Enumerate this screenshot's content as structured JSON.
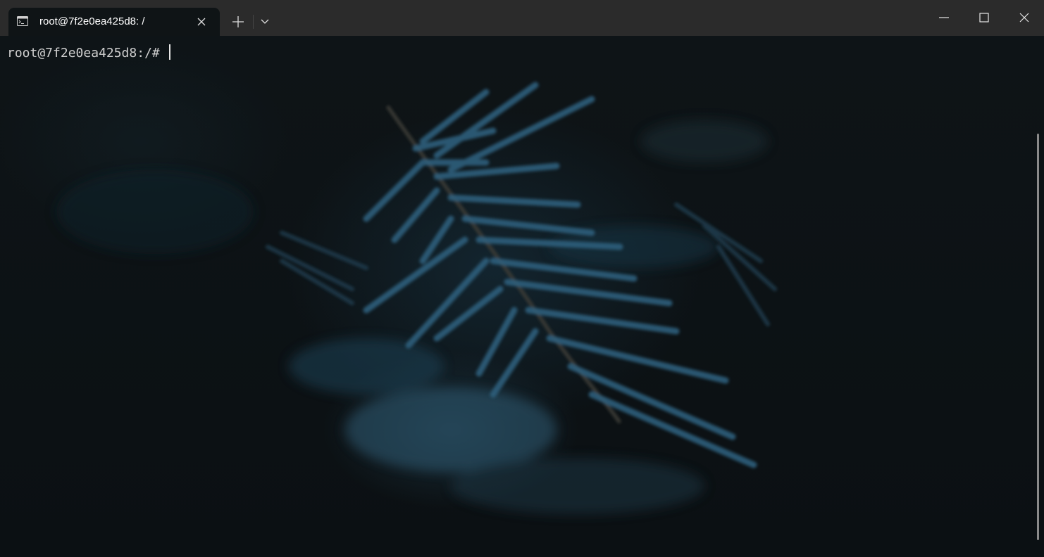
{
  "window": {
    "tab_title": "root@7f2e0ea425d8: /",
    "tab_icon": "terminal-icon",
    "new_tab_icon": "plus-icon",
    "dropdown_icon": "chevron-down-icon",
    "minimize_icon": "minimize-icon",
    "maximize_icon": "maximize-icon",
    "close_icon": "close-icon"
  },
  "terminal": {
    "prompt": "root@7f2e0ea425d8:/# ",
    "background": "dark fern branch wallpaper"
  },
  "colors": {
    "titlebar": "#2b2b2b",
    "tab": "#0f1416",
    "terminal_bg": "#0d1114",
    "text": "#cfcfcf"
  }
}
